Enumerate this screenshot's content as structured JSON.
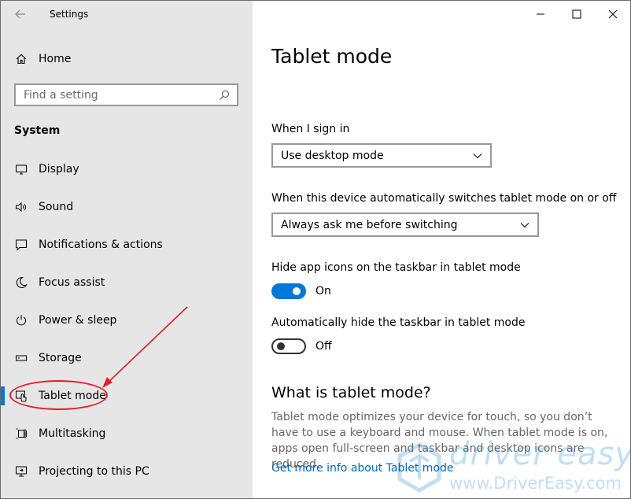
{
  "window": {
    "app_title": "Settings",
    "controls": {
      "minimize": "minimize",
      "maximize": "maximize",
      "close": "close"
    }
  },
  "sidebar": {
    "home_label": "Home",
    "search_placeholder": "Find a setting",
    "section_heading": "System",
    "items": [
      {
        "label": "Display",
        "icon": "display-icon"
      },
      {
        "label": "Sound",
        "icon": "sound-icon"
      },
      {
        "label": "Notifications & actions",
        "icon": "notifications-icon"
      },
      {
        "label": "Focus assist",
        "icon": "moon-icon"
      },
      {
        "label": "Power & sleep",
        "icon": "power-icon"
      },
      {
        "label": "Storage",
        "icon": "storage-icon"
      },
      {
        "label": "Tablet mode",
        "icon": "tablet-mode-icon",
        "selected": true
      },
      {
        "label": "Multitasking",
        "icon": "multitasking-icon"
      },
      {
        "label": "Projecting to this PC",
        "icon": "projecting-icon"
      }
    ]
  },
  "main": {
    "title": "Tablet mode",
    "sign_in": {
      "label": "When I sign in",
      "value": "Use desktop mode"
    },
    "auto_switch": {
      "label": "When this device automatically switches tablet mode on or off",
      "value": "Always ask me before switching"
    },
    "hide_icons": {
      "label": "Hide app icons on the taskbar in tablet mode",
      "state": "On",
      "on": true
    },
    "hide_taskbar": {
      "label": "Automatically hide the taskbar in tablet mode",
      "state": "Off",
      "on": false
    },
    "what_is_heading": "What is tablet mode?",
    "description": "Tablet mode optimizes your device for touch, so you don’t have to use a keyboard and mouse. When tablet mode is on, apps open full-screen and taskbar and desktop icons are reduced.",
    "more_info_link": "Get more info about Tablet mode"
  },
  "watermark": {
    "brand": "driver easy",
    "url": "www.DriverEasy.com"
  },
  "colors": {
    "accent": "#0078d7",
    "link": "#0067b8",
    "annotation": "#e0202a",
    "sidebar_bg": "#e6e6e6"
  }
}
